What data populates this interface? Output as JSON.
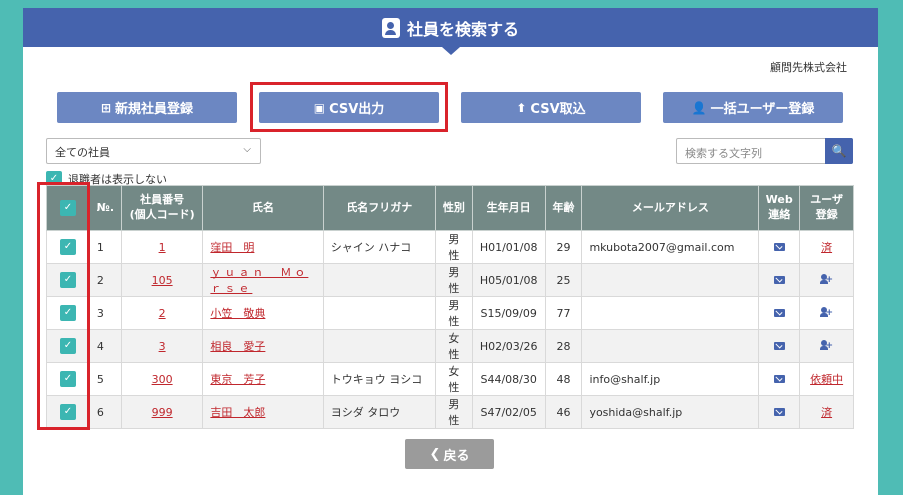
{
  "header": {
    "title": "社員を検索する"
  },
  "company": "顧問先株式会社",
  "buttons": {
    "new_employee": "新規社員登録",
    "csv_export": "CSV出力",
    "csv_import": "CSV取込",
    "bulk_user": "一括ユーザー登録",
    "back": "戻る"
  },
  "filter": {
    "selected": "全ての社員"
  },
  "search": {
    "placeholder": "検索する文字列"
  },
  "retired_toggle": "退職者は表示しない",
  "table": {
    "headers": {
      "no": "№.",
      "emp_no_1": "社員番号",
      "emp_no_2": "(個人コード)",
      "name": "氏名",
      "furigana": "氏名フリガナ",
      "gender": "性別",
      "birth": "生年月日",
      "age": "年齢",
      "email": "メールアドレス",
      "web_1": "Web",
      "web_2": "連絡",
      "user_1": "ユーザ",
      "user_2": "登録"
    },
    "rows": [
      {
        "no": "1",
        "code": "1",
        "name": "窪田　明",
        "kana": "シャイン ハナコ",
        "gender": "男性",
        "birth": "H01/01/08",
        "age": "29",
        "email": "mkubota2007@gmail.com",
        "user": "済"
      },
      {
        "no": "2",
        "code": "105",
        "name": "ｙｕａｎ　Ｍｏｒｓｅ",
        "kana": "",
        "gender": "男性",
        "birth": "H05/01/08",
        "age": "25",
        "email": "",
        "user": ""
      },
      {
        "no": "3",
        "code": "2",
        "name": "小笠　敬典",
        "kana": "",
        "gender": "男性",
        "birth": "S15/09/09",
        "age": "77",
        "email": "",
        "user": ""
      },
      {
        "no": "4",
        "code": "3",
        "name": "相良　愛子",
        "kana": "",
        "gender": "女性",
        "birth": "H02/03/26",
        "age": "28",
        "email": "",
        "user": ""
      },
      {
        "no": "5",
        "code": "300",
        "name": "東京　芳子",
        "kana": "トウキョウ ヨシコ",
        "gender": "女性",
        "birth": "S44/08/30",
        "age": "48",
        "email": "info@shalf.jp",
        "user": "依頼中"
      },
      {
        "no": "6",
        "code": "999",
        "name": "吉田　太郎",
        "kana": "ヨシダ タロウ",
        "gender": "男性",
        "birth": "S47/02/05",
        "age": "46",
        "email": "yoshida@shalf.jp",
        "user": "済"
      }
    ]
  },
  "colors": {
    "header_blue": "#4563ad",
    "button_blue": "#6c87c2",
    "teal": "#3cb6b2",
    "highlight_red": "#d9232b"
  }
}
